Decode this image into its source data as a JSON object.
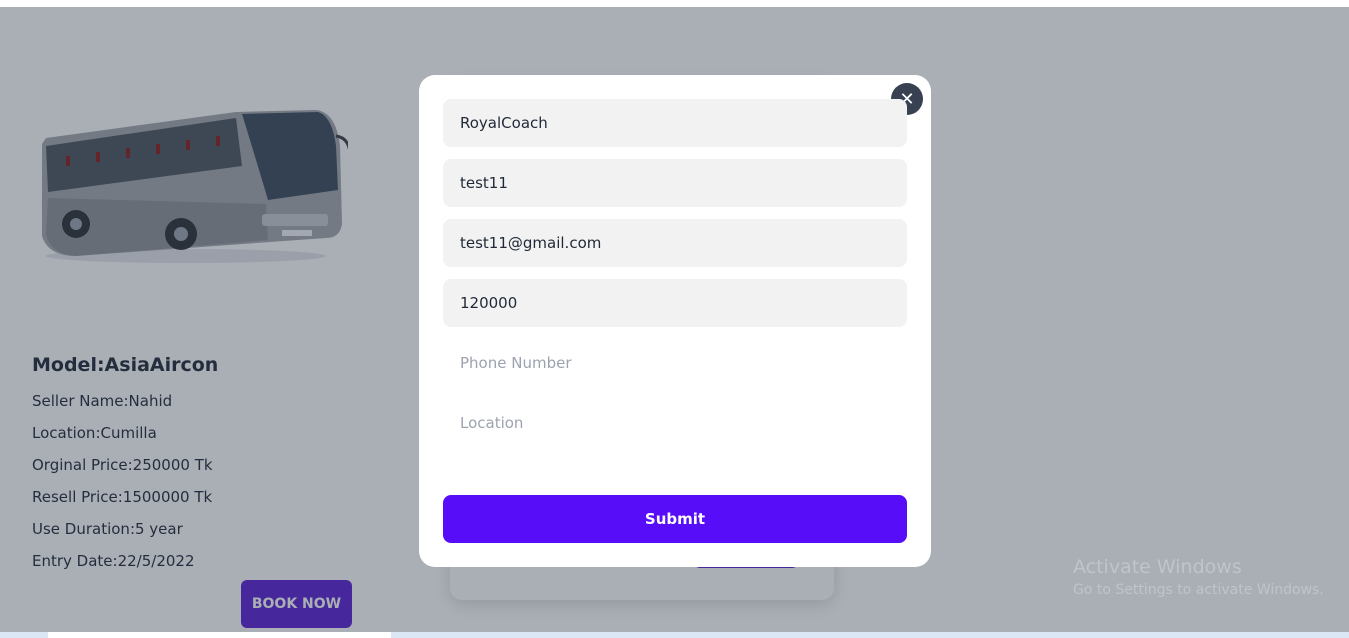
{
  "card": {
    "model": "Model:AsiaAircon",
    "seller": "Seller Name:Nahid",
    "location": "Location:Cumilla",
    "original_price": "Orginal Price:250000 Tk",
    "resell_price": "Resell Price:1500000 Tk",
    "use_duration": "Use Duration:5 year",
    "entry_date": "Entry Date:22/5/2022",
    "book_button": "BOOK NOW"
  },
  "modal": {
    "close_icon": "close-icon",
    "fields": {
      "product_name": "RoyalCoach",
      "user_name": "test11",
      "email": "test11@gmail.com",
      "price": "120000",
      "phone_placeholder": "Phone Number",
      "location_placeholder": "Location"
    },
    "submit_label": "Submit"
  },
  "watermark": {
    "line1": "Activate Windows",
    "line2": "Go to Settings to activate Windows."
  },
  "colors": {
    "accent": "#570df8",
    "book_button": "#5b21d6",
    "overlay": "#2b3545"
  }
}
